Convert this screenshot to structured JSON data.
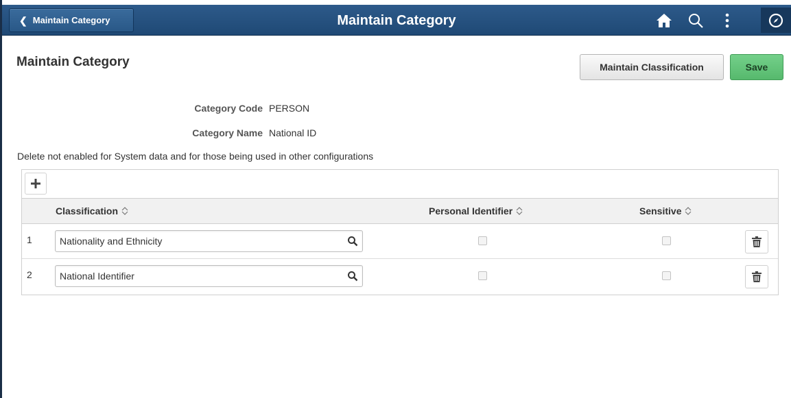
{
  "header": {
    "back_label": "Maintain Category",
    "title": "Maintain Category",
    "icons": [
      "home-icon",
      "search-icon",
      "actions-menu-icon",
      "navbar-icon"
    ]
  },
  "page": {
    "title": "Maintain Category",
    "buttons": {
      "maintain_classification": "Maintain Classification",
      "save": "Save"
    }
  },
  "fields": {
    "category_code_label": "Category Code",
    "category_code_value": "PERSON",
    "category_name_label": "Category Name",
    "category_name_value": "National ID"
  },
  "notice": "Delete not enabled for System data and for those being used in other configurations",
  "grid": {
    "columns": {
      "classification": "Classification",
      "personal_identifier": "Personal Identifier",
      "sensitive": "Sensitive"
    },
    "rows": [
      {
        "num": "1",
        "classification": "Nationality and Ethnicity",
        "personal_identifier": false,
        "sensitive": false
      },
      {
        "num": "2",
        "classification": "National Identifier",
        "personal_identifier": false,
        "sensitive": false
      }
    ]
  },
  "colors": {
    "header_bg": "#1f4975",
    "save_green": "#5cbf73",
    "text": "#333333"
  }
}
